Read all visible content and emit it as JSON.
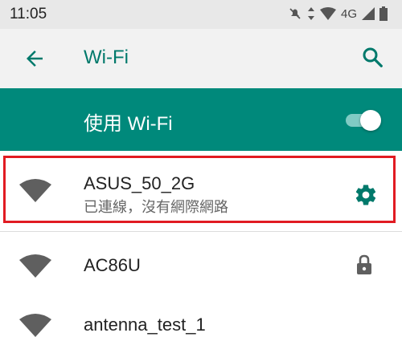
{
  "status_bar": {
    "time": "11:05",
    "network_label": "4G"
  },
  "header": {
    "title": "Wi-Fi"
  },
  "wifi_toggle": {
    "label": "使用 Wi-Fi",
    "enabled": true
  },
  "networks": [
    {
      "ssid": "ASUS_50_2G",
      "status": "已連線，沒有網際網路",
      "icon": "wifi-signal-icon",
      "trailing": "gear-icon"
    },
    {
      "ssid": "AC86U",
      "icon": "wifi-signal-icon",
      "trailing": "lock-icon"
    },
    {
      "ssid": "antenna_test_1",
      "icon": "wifi-signal-icon"
    }
  ],
  "colors": {
    "accent": "#00897b",
    "title": "#00796b",
    "highlight": "#e11b22"
  }
}
